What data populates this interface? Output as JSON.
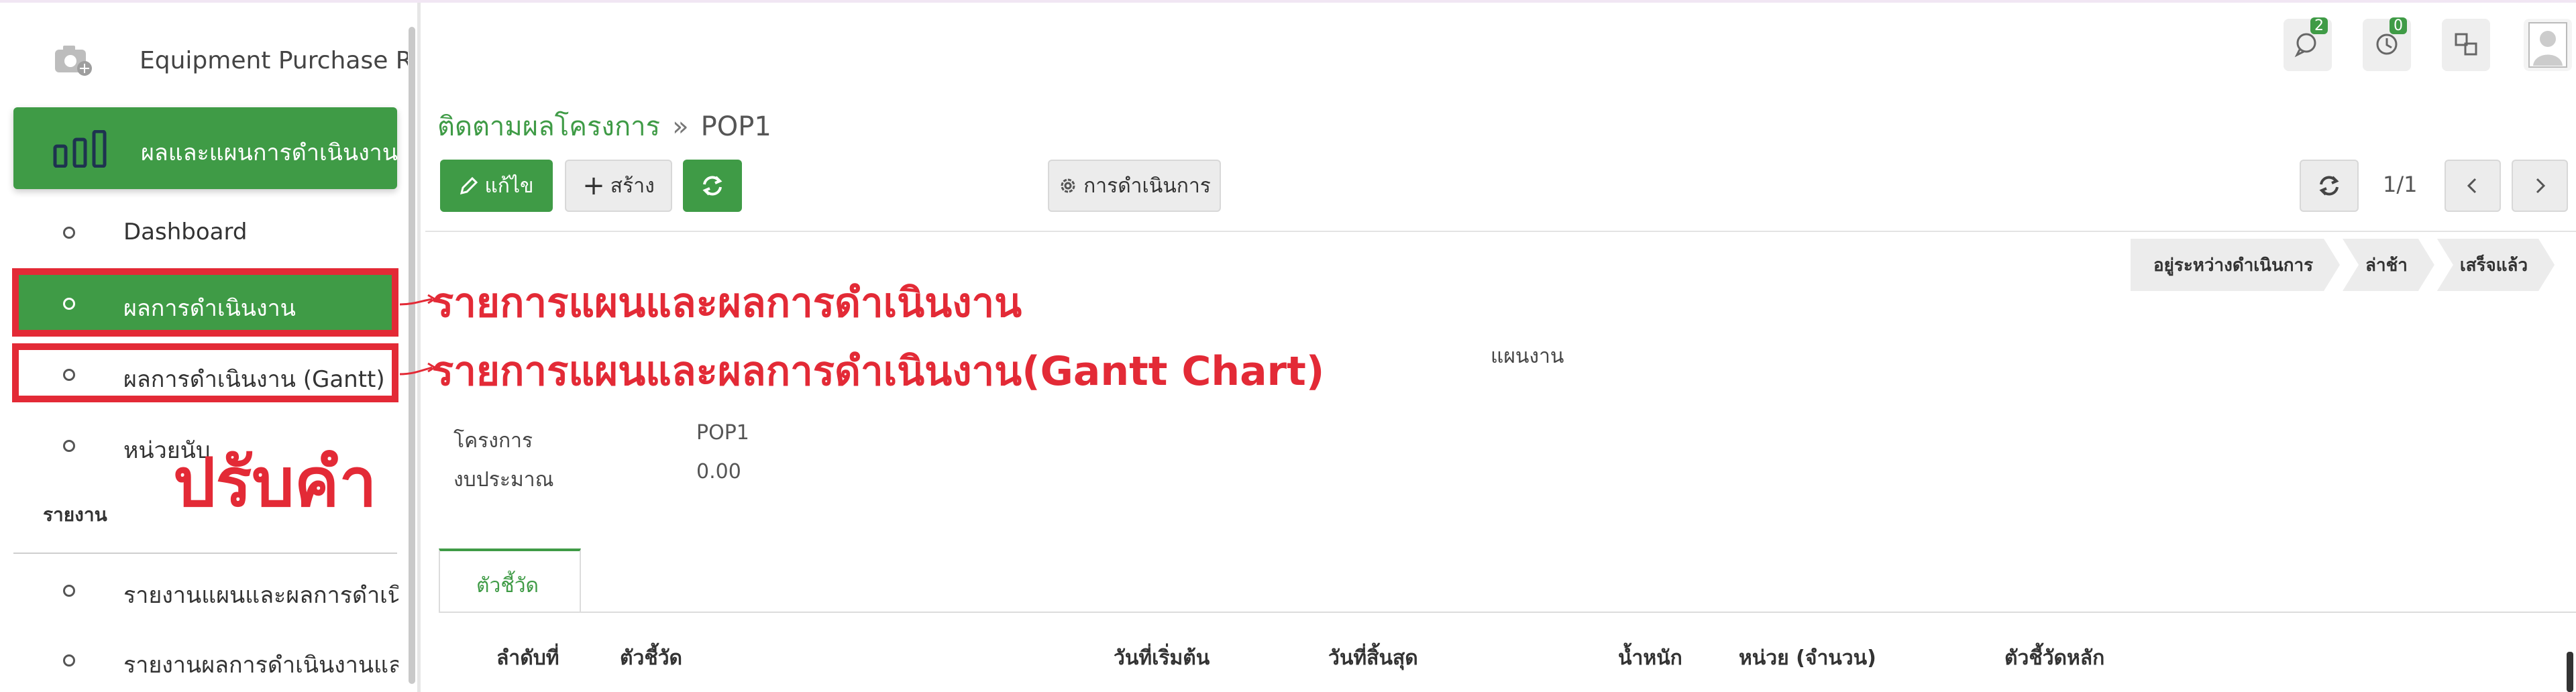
{
  "sidebar": {
    "app_name": "Equipment Purchase Re",
    "section_label": "ผลและแผนการดำเนินงาน",
    "items": [
      {
        "label": "Dashboard"
      },
      {
        "label": "ผลการดำเนินงาน"
      },
      {
        "label": "ผลการดำเนินงาน (Gantt)"
      },
      {
        "label": "หน่วยนับ"
      }
    ],
    "report_header": "รายงาน",
    "report_items": [
      {
        "label": "รายงานแผนและผลการดำเนิน"
      },
      {
        "label": "รายงานผลการดำเนินงานและก"
      }
    ]
  },
  "annotations": {
    "line1": "รายการแผนและผลการดำเนินงาน",
    "line2": "รายการแผนและผลการดำเนินงาน(Gantt Chart)",
    "note": "ปรับคำ"
  },
  "topbar": {
    "chat_badge": "2",
    "activity_badge": "0"
  },
  "breadcrumb": {
    "parent": "ติดตามผลโครงการ",
    "separator": "»",
    "current": "POP1"
  },
  "toolbar": {
    "edit_label": "แก้ไข",
    "create_label": "สร้าง",
    "action_label": "การดำเนินการ",
    "pager": "1/1"
  },
  "status_steps": [
    "อยู่ระหว่างดำเนินการ",
    "ล่าช้า",
    "เสร็จแล้ว"
  ],
  "form": {
    "plan_label": "แผนงาน",
    "project_label": "โครงการ",
    "project_value": "POP1",
    "budget_label": "งบประมาณ",
    "budget_value": "0.00"
  },
  "tabs": [
    {
      "label": "ตัวชี้วัด"
    }
  ],
  "table": {
    "headers": [
      "ลำดับที่",
      "ตัวชี้วัด",
      "วันที่เริ่มต้น",
      "วันที่สิ้นสุด",
      "น้ำหนัก",
      "หน่วย (จำนวน)",
      "ตัวชี้วัดหลัก"
    ]
  },
  "colors": {
    "accent": "#3f9b46",
    "annotation": "#e32a36"
  }
}
